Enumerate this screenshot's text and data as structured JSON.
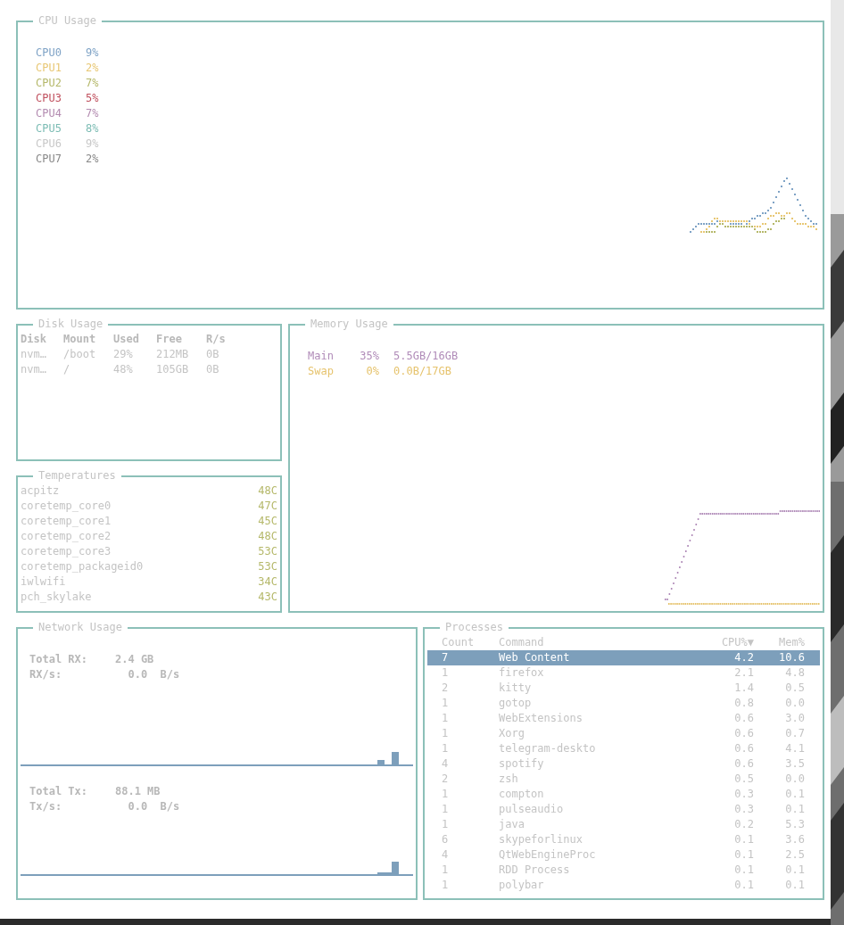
{
  "cpu_usage": {
    "title": "CPU Usage",
    "cores": [
      {
        "name": "CPU0",
        "percent": "9%",
        "color": "#7fa3c6"
      },
      {
        "name": "CPU1",
        "percent": "2%",
        "color": "#e8c774"
      },
      {
        "name": "CPU2",
        "percent": "7%",
        "color": "#b5b86a"
      },
      {
        "name": "CPU3",
        "percent": "5%",
        "color": "#c0505e"
      },
      {
        "name": "CPU4",
        "percent": "7%",
        "color": "#b38bb0"
      },
      {
        "name": "CPU5",
        "percent": "8%",
        "color": "#7cbcb4"
      },
      {
        "name": "CPU6",
        "percent": "9%",
        "color": "#c8c8c8"
      },
      {
        "name": "CPU7",
        "percent": "2%",
        "color": "#888888"
      }
    ]
  },
  "disk_usage": {
    "title": "Disk Usage",
    "columns": [
      "Disk",
      "Mount",
      "Used",
      "Free",
      "R/s"
    ],
    "rows": [
      [
        "nvm…",
        "/boot",
        "29%",
        "212MB",
        "0B"
      ],
      [
        "nvm…",
        "/",
        "48%",
        "105GB",
        "0B"
      ]
    ]
  },
  "temperatures": {
    "title": "Temperatures",
    "sensors": [
      {
        "name": "acpitz",
        "value": "48C"
      },
      {
        "name": "coretemp_core0",
        "value": "47C"
      },
      {
        "name": "coretemp_core1",
        "value": "45C"
      },
      {
        "name": "coretemp_core2",
        "value": "48C"
      },
      {
        "name": "coretemp_core3",
        "value": "53C"
      },
      {
        "name": "coretemp_packageid0",
        "value": "53C"
      },
      {
        "name": "iwlwifi",
        "value": "34C"
      },
      {
        "name": "pch_skylake",
        "value": "43C"
      }
    ]
  },
  "memory_usage": {
    "title": "Memory Usage",
    "series": [
      {
        "name": "Main",
        "percent": "35%",
        "amount": "5.5GB/16GB",
        "color": "#b08bb8"
      },
      {
        "name": "Swap",
        "percent": "0%",
        "amount": "0.0B/17GB",
        "color": "#e6c36d"
      }
    ]
  },
  "network_usage": {
    "title": "Network Usage",
    "receive": {
      "total_label": "Total RX:",
      "total": "2.4 GB",
      "rate_label": "RX/s:",
      "rate": "0.0  B/s"
    },
    "transmit": {
      "total_label": "Total Tx:",
      "total": "88.1 MB",
      "rate_label": "Tx/s:",
      "rate": "0.0  B/s"
    }
  },
  "processes": {
    "title": "Processes",
    "columns": [
      "Count",
      "Command",
      "CPU%▼",
      "Mem%"
    ],
    "rows": [
      {
        "count": "7",
        "command": "Web Content",
        "cpu": "4.2",
        "mem": "10.6",
        "selected": true
      },
      {
        "count": "1",
        "command": "firefox",
        "cpu": "2.1",
        "mem": "4.8",
        "selected": false
      },
      {
        "count": "2",
        "command": "kitty",
        "cpu": "1.4",
        "mem": "0.5",
        "selected": false
      },
      {
        "count": "1",
        "command": "gotop",
        "cpu": "0.8",
        "mem": "0.0",
        "selected": false
      },
      {
        "count": "1",
        "command": "WebExtensions",
        "cpu": "0.6",
        "mem": "3.0",
        "selected": false
      },
      {
        "count": "1",
        "command": "Xorg",
        "cpu": "0.6",
        "mem": "0.7",
        "selected": false
      },
      {
        "count": "1",
        "command": "telegram-deskto",
        "cpu": "0.6",
        "mem": "4.1",
        "selected": false
      },
      {
        "count": "4",
        "command": "spotify",
        "cpu": "0.6",
        "mem": "3.5",
        "selected": false
      },
      {
        "count": "2",
        "command": "zsh",
        "cpu": "0.5",
        "mem": "0.0",
        "selected": false
      },
      {
        "count": "1",
        "command": "compton",
        "cpu": "0.3",
        "mem": "0.1",
        "selected": false
      },
      {
        "count": "1",
        "command": "pulseaudio",
        "cpu": "0.3",
        "mem": "0.1",
        "selected": false
      },
      {
        "count": "1",
        "command": "java",
        "cpu": "0.2",
        "mem": "5.3",
        "selected": false
      },
      {
        "count": "6",
        "command": "skypeforlinux",
        "cpu": "0.1",
        "mem": "3.6",
        "selected": false
      },
      {
        "count": "4",
        "command": "QtWebEngineProc",
        "cpu": "0.1",
        "mem": "2.5",
        "selected": false
      },
      {
        "count": "1",
        "command": "RDD Process",
        "cpu": "0.1",
        "mem": "0.1",
        "selected": false
      },
      {
        "count": "1",
        "command": "polybar",
        "cpu": "0.1",
        "mem": "0.1",
        "selected": false
      }
    ]
  }
}
